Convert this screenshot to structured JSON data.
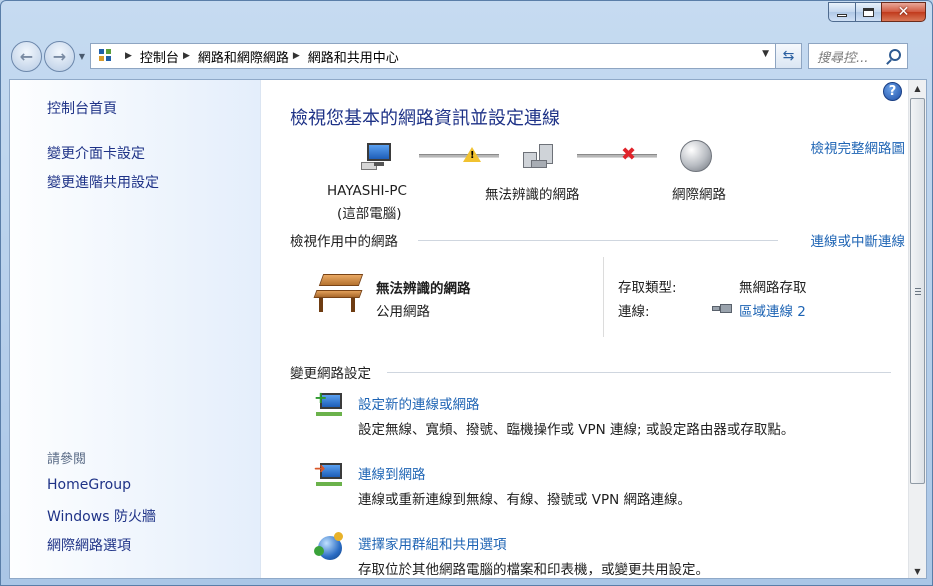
{
  "window": {
    "caption_buttons": {
      "minimize": "minimize",
      "maximize": "maximize",
      "close": "✕"
    }
  },
  "navigation": {
    "breadcrumbs": [
      "控制台",
      "網路和網際網路",
      "網路和共用中心"
    ],
    "search_placeholder": "搜尋控..."
  },
  "sidebar": {
    "home": "控制台首頁",
    "links": [
      "變更介面卡設定",
      "變更進階共用設定"
    ],
    "see_also_title": "請參閱",
    "see_also": [
      "HomeGroup",
      "Windows 防火牆",
      "網際網路選項"
    ]
  },
  "main": {
    "title": "檢視您基本的網路資訊並設定連線",
    "full_map_link": "檢視完整網路圖",
    "map": {
      "computer_name": "HAYASHI-PC",
      "computer_sub": "(這部電腦)",
      "unidentified": "無法辨識的網路",
      "internet": "網際網路"
    },
    "active_section_title": "檢視作用中的網路",
    "connect_disconnect_link": "連線或中斷連線",
    "active_network": {
      "name": "無法辨識的網路",
      "type": "公用網路",
      "access_type_label": "存取類型:",
      "access_type_value": "無網路存取",
      "connections_label": "連線:",
      "connection_value": "區域連線 2"
    },
    "change_section_title": "變更網路設定",
    "tasks": [
      {
        "title": "設定新的連線或網路",
        "desc": "設定無線、寬頻、撥號、臨機操作或 VPN 連線; 或設定路由器或存取點。"
      },
      {
        "title": "連線到網路",
        "desc": "連線或重新連線到無線、有線、撥號或 VPN 網路連線。"
      },
      {
        "title": "選擇家用群組和共用選項",
        "desc": "存取位於其他網路電腦的檔案和印表機，或變更共用設定。"
      }
    ]
  },
  "colors": {
    "link": "#1e64b4",
    "title": "#1e3287",
    "warning": "#f1c230",
    "error": "#e0232a"
  }
}
